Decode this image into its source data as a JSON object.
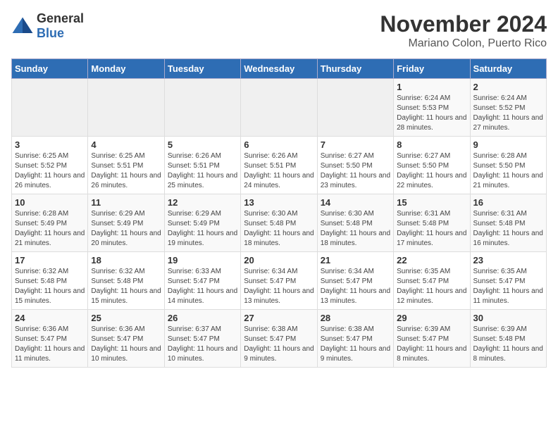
{
  "header": {
    "logo_general": "General",
    "logo_blue": "Blue",
    "month_title": "November 2024",
    "location": "Mariano Colon, Puerto Rico"
  },
  "weekdays": [
    "Sunday",
    "Monday",
    "Tuesday",
    "Wednesday",
    "Thursday",
    "Friday",
    "Saturday"
  ],
  "weeks": [
    [
      {
        "day": "",
        "info": ""
      },
      {
        "day": "",
        "info": ""
      },
      {
        "day": "",
        "info": ""
      },
      {
        "day": "",
        "info": ""
      },
      {
        "day": "",
        "info": ""
      },
      {
        "day": "1",
        "info": "Sunrise: 6:24 AM\nSunset: 5:53 PM\nDaylight: 11 hours and 28 minutes."
      },
      {
        "day": "2",
        "info": "Sunrise: 6:24 AM\nSunset: 5:52 PM\nDaylight: 11 hours and 27 minutes."
      }
    ],
    [
      {
        "day": "3",
        "info": "Sunrise: 6:25 AM\nSunset: 5:52 PM\nDaylight: 11 hours and 26 minutes."
      },
      {
        "day": "4",
        "info": "Sunrise: 6:25 AM\nSunset: 5:51 PM\nDaylight: 11 hours and 26 minutes."
      },
      {
        "day": "5",
        "info": "Sunrise: 6:26 AM\nSunset: 5:51 PM\nDaylight: 11 hours and 25 minutes."
      },
      {
        "day": "6",
        "info": "Sunrise: 6:26 AM\nSunset: 5:51 PM\nDaylight: 11 hours and 24 minutes."
      },
      {
        "day": "7",
        "info": "Sunrise: 6:27 AM\nSunset: 5:50 PM\nDaylight: 11 hours and 23 minutes."
      },
      {
        "day": "8",
        "info": "Sunrise: 6:27 AM\nSunset: 5:50 PM\nDaylight: 11 hours and 22 minutes."
      },
      {
        "day": "9",
        "info": "Sunrise: 6:28 AM\nSunset: 5:50 PM\nDaylight: 11 hours and 21 minutes."
      }
    ],
    [
      {
        "day": "10",
        "info": "Sunrise: 6:28 AM\nSunset: 5:49 PM\nDaylight: 11 hours and 21 minutes."
      },
      {
        "day": "11",
        "info": "Sunrise: 6:29 AM\nSunset: 5:49 PM\nDaylight: 11 hours and 20 minutes."
      },
      {
        "day": "12",
        "info": "Sunrise: 6:29 AM\nSunset: 5:49 PM\nDaylight: 11 hours and 19 minutes."
      },
      {
        "day": "13",
        "info": "Sunrise: 6:30 AM\nSunset: 5:48 PM\nDaylight: 11 hours and 18 minutes."
      },
      {
        "day": "14",
        "info": "Sunrise: 6:30 AM\nSunset: 5:48 PM\nDaylight: 11 hours and 18 minutes."
      },
      {
        "day": "15",
        "info": "Sunrise: 6:31 AM\nSunset: 5:48 PM\nDaylight: 11 hours and 17 minutes."
      },
      {
        "day": "16",
        "info": "Sunrise: 6:31 AM\nSunset: 5:48 PM\nDaylight: 11 hours and 16 minutes."
      }
    ],
    [
      {
        "day": "17",
        "info": "Sunrise: 6:32 AM\nSunset: 5:48 PM\nDaylight: 11 hours and 15 minutes."
      },
      {
        "day": "18",
        "info": "Sunrise: 6:32 AM\nSunset: 5:48 PM\nDaylight: 11 hours and 15 minutes."
      },
      {
        "day": "19",
        "info": "Sunrise: 6:33 AM\nSunset: 5:47 PM\nDaylight: 11 hours and 14 minutes."
      },
      {
        "day": "20",
        "info": "Sunrise: 6:34 AM\nSunset: 5:47 PM\nDaylight: 11 hours and 13 minutes."
      },
      {
        "day": "21",
        "info": "Sunrise: 6:34 AM\nSunset: 5:47 PM\nDaylight: 11 hours and 13 minutes."
      },
      {
        "day": "22",
        "info": "Sunrise: 6:35 AM\nSunset: 5:47 PM\nDaylight: 11 hours and 12 minutes."
      },
      {
        "day": "23",
        "info": "Sunrise: 6:35 AM\nSunset: 5:47 PM\nDaylight: 11 hours and 11 minutes."
      }
    ],
    [
      {
        "day": "24",
        "info": "Sunrise: 6:36 AM\nSunset: 5:47 PM\nDaylight: 11 hours and 11 minutes."
      },
      {
        "day": "25",
        "info": "Sunrise: 6:36 AM\nSunset: 5:47 PM\nDaylight: 11 hours and 10 minutes."
      },
      {
        "day": "26",
        "info": "Sunrise: 6:37 AM\nSunset: 5:47 PM\nDaylight: 11 hours and 10 minutes."
      },
      {
        "day": "27",
        "info": "Sunrise: 6:38 AM\nSunset: 5:47 PM\nDaylight: 11 hours and 9 minutes."
      },
      {
        "day": "28",
        "info": "Sunrise: 6:38 AM\nSunset: 5:47 PM\nDaylight: 11 hours and 9 minutes."
      },
      {
        "day": "29",
        "info": "Sunrise: 6:39 AM\nSunset: 5:47 PM\nDaylight: 11 hours and 8 minutes."
      },
      {
        "day": "30",
        "info": "Sunrise: 6:39 AM\nSunset: 5:48 PM\nDaylight: 11 hours and 8 minutes."
      }
    ]
  ]
}
